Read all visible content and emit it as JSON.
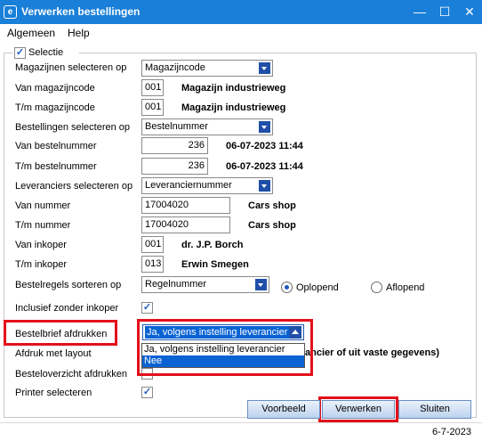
{
  "window": {
    "title": "Verwerken bestellingen",
    "app_icon": "e",
    "minimize": "—",
    "maximize": "☐",
    "close": "✕"
  },
  "menu": {
    "items": [
      "Algemeen",
      "Help"
    ]
  },
  "selectie": {
    "label": "Selectie",
    "checked": true
  },
  "rows": {
    "magazijnen_selecteren_op": {
      "label": "Magazijnen selecteren op",
      "value": "Magazijncode"
    },
    "van_magazijncode": {
      "label": "Van magazijncode",
      "value": "001",
      "desc": "Magazijn industrieweg"
    },
    "tm_magazijncode": {
      "label": "T/m magazijncode",
      "value": "001",
      "desc": "Magazijn industrieweg"
    },
    "bestellingen_selecteren_op": {
      "label": "Bestellingen selecteren op",
      "value": "Bestelnummer"
    },
    "van_bestelnummer": {
      "label": "Van bestelnummer",
      "value": "236",
      "desc": "06-07-2023 11:44"
    },
    "tm_bestelnummer": {
      "label": "T/m bestelnummer",
      "value": "236",
      "desc": "06-07-2023 11:44"
    },
    "leveranciers_selecteren_op": {
      "label": "Leveranciers selecteren op",
      "value": "Leveranciernummer"
    },
    "van_nummer": {
      "label": "Van nummer",
      "value": "17004020",
      "desc": "Cars shop"
    },
    "tm_nummer": {
      "label": "T/m nummer",
      "value": "17004020",
      "desc": "Cars shop"
    },
    "van_inkoper": {
      "label": "Van inkoper",
      "value": "001",
      "desc": "dr. J.P. Borch"
    },
    "tm_inkoper": {
      "label": "T/m inkoper",
      "value": "013",
      "desc": "Erwin Smegen"
    },
    "bestelregels_sorteren_op": {
      "label": "Bestelregels sorteren op",
      "value": "Regelnummer",
      "radio_asc": "Oplopend",
      "radio_desc": "Aflopend"
    },
    "inclusief_zonder_inkoper": {
      "label": "Inclusief zonder inkoper",
      "checked": true
    },
    "bestelbrief_afdrukken": {
      "label": "Bestelbrief afdrukken",
      "value": "Ja, volgens instelling leverancier",
      "options": [
        "Ja, volgens instelling leverancier",
        "Nee"
      ],
      "highlighted_option": "Nee"
    },
    "afdruk_met_layout": {
      "label": "Afdruk met layout",
      "partial_text": "ancier of uit vaste gegevens)"
    },
    "besteloverzicht_afdrukken": {
      "label": "Besteloverzicht afdrukken"
    },
    "printer_selecteren": {
      "label": "Printer selecteren",
      "checked": true
    }
  },
  "buttons": {
    "voorbeeld": "Voorbeeld",
    "verwerken": "Verwerken",
    "sluiten": "Sluiten"
  },
  "status": {
    "date": "6-7-2023"
  },
  "colors": {
    "titlebar": "#1a7fd8",
    "highlight": "#e3101a",
    "selection": "#0a63d4"
  }
}
